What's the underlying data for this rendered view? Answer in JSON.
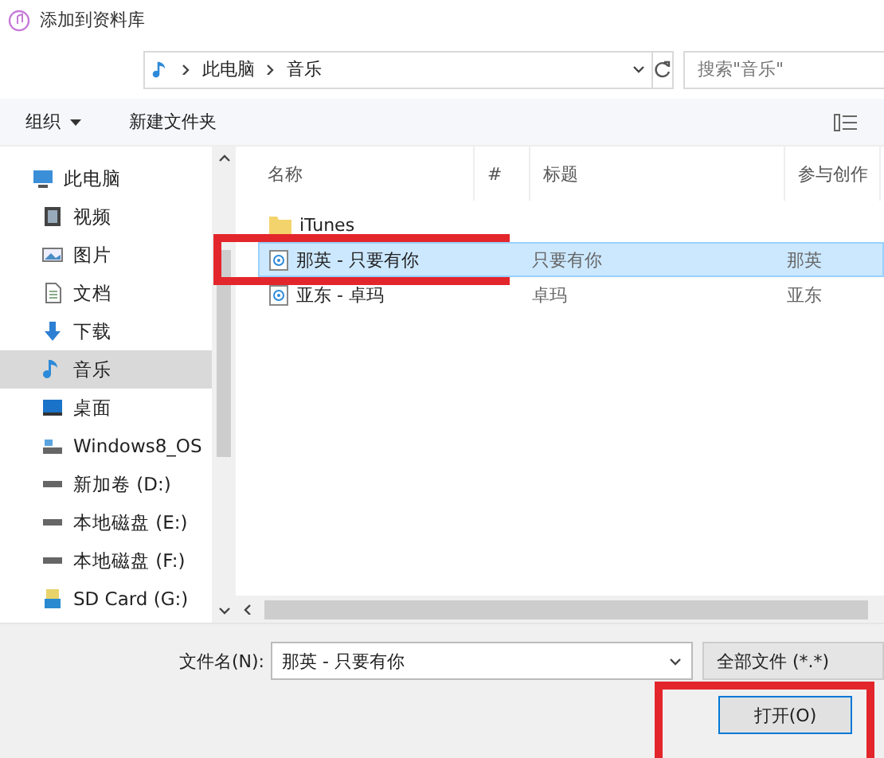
{
  "window": {
    "title": "添加到资料库"
  },
  "address": {
    "crumbs": [
      "此电脑",
      "音乐"
    ]
  },
  "search": {
    "placeholder": "搜索\"音乐\""
  },
  "toolbar": {
    "organize": "组织",
    "new_folder": "新建文件夹"
  },
  "sidebar": {
    "items": [
      {
        "label": "此电脑",
        "kind": "computer",
        "selected": false,
        "children": [
          {
            "label": "视频",
            "kind": "video",
            "selected": false
          },
          {
            "label": "图片",
            "kind": "pictures",
            "selected": false
          },
          {
            "label": "文档",
            "kind": "documents",
            "selected": false
          },
          {
            "label": "下载",
            "kind": "downloads",
            "selected": false
          },
          {
            "label": "音乐",
            "kind": "music",
            "selected": true
          },
          {
            "label": "桌面",
            "kind": "desktop",
            "selected": false
          },
          {
            "label": "Windows8_OS",
            "kind": "system_drive",
            "selected": false
          },
          {
            "label": "新加卷 (D:)",
            "kind": "drive",
            "selected": false
          },
          {
            "label": "本地磁盘 (E:)",
            "kind": "drive",
            "selected": false
          },
          {
            "label": "本地磁盘 (F:)",
            "kind": "drive",
            "selected": false
          },
          {
            "label": "SD Card (G:)",
            "kind": "sdcard",
            "selected": false
          }
        ]
      }
    ]
  },
  "table": {
    "columns": [
      "名称",
      "#",
      "标题",
      "参与创作"
    ],
    "rows": [
      {
        "kind": "folder",
        "name": "iTunes",
        "selected": false,
        "highlighted": false
      },
      {
        "kind": "music",
        "name": "那英 - 只要有你",
        "title": "只要有你",
        "artist": "那英",
        "selected": true,
        "highlighted": true
      },
      {
        "kind": "music",
        "name": "亚东 - 卓玛",
        "title": "卓玛",
        "artist": "亚东",
        "selected": false,
        "highlighted": false
      }
    ]
  },
  "footer": {
    "filename_label": "文件名(N):",
    "filename": "那英 - 只要有你",
    "filter": "全部文件 (*.*)",
    "open_button": {
      "label": "打开(O)",
      "highlighted": true
    }
  }
}
